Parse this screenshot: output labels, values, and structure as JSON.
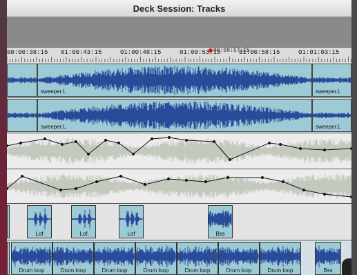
{
  "window": {
    "title": "Deck Session:  Tracks"
  },
  "timeline": {
    "ticks": [
      "00:00:38:15",
      "01:00:43:15",
      "01:00:48:15",
      "01:00:53:15",
      "01:00:58:15",
      "01:01:03:15"
    ],
    "cursor_label": "00:00:57:15"
  },
  "tracks": {
    "sweeper_left": {
      "regions": [
        {
          "label": ""
        },
        {
          "label": "sweeper.L"
        },
        {
          "label": "sweeper.L"
        }
      ]
    },
    "sweeper_right": {
      "regions": [
        {
          "label": ""
        },
        {
          "label": "sweeper.L"
        },
        {
          "label": "sweeper.L"
        }
      ]
    },
    "lof": {
      "clips": [
        "",
        "Lof",
        "Lof",
        "Lof",
        "Bss"
      ]
    },
    "drums": {
      "clips": [
        "",
        "Drum loop",
        "Drum loop",
        "Drum loop",
        "Drum loop",
        "Drum loop",
        "Drum loop",
        "Drum loop",
        "Bss"
      ]
    }
  },
  "colors": {
    "waveform": "#2a4a9a",
    "region": "#9ccbd6",
    "cursor": "#d01818"
  }
}
